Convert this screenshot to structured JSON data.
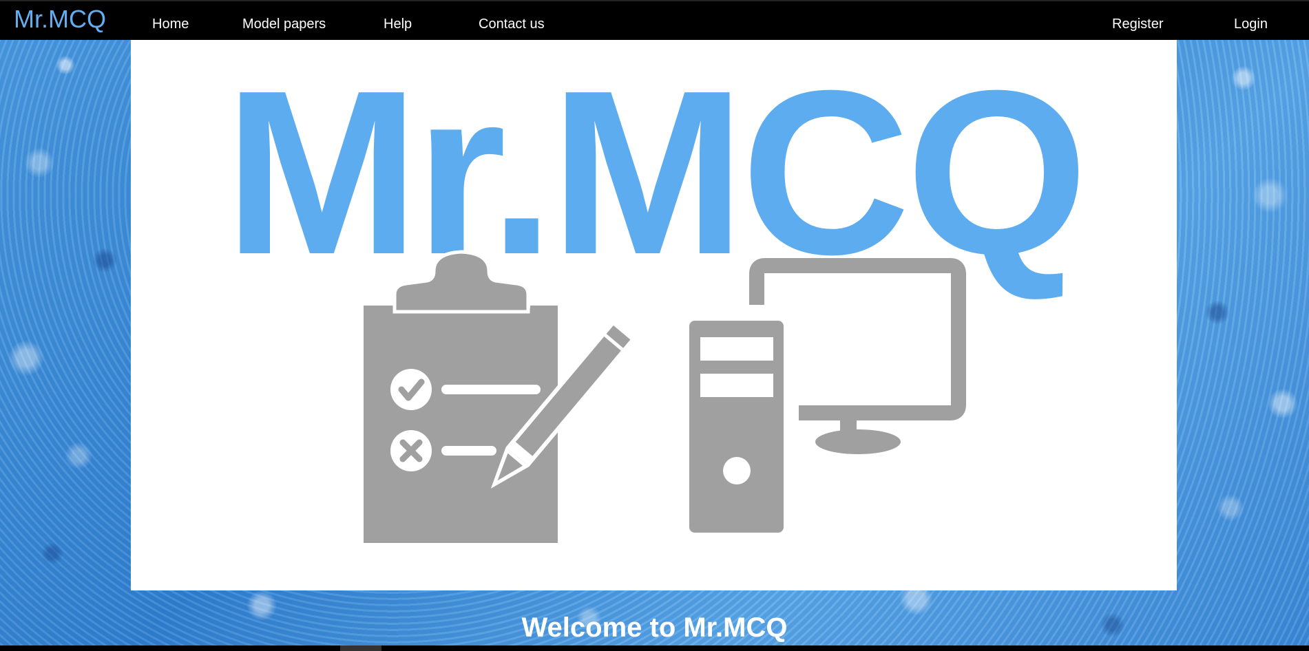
{
  "navbar": {
    "brand": "Mr.MCQ",
    "links": {
      "home": "Home",
      "model_papers": "Model papers",
      "help": "Help",
      "contact": "Contact us",
      "register": "Register",
      "login": "Login"
    }
  },
  "hero": {
    "logo_text": "Mr.MCQ",
    "icons": [
      "clipboard-checklist-icon",
      "pencil-icon",
      "desktop-computer-icon"
    ],
    "colors": {
      "logo_blue": "#5eacf0",
      "icon_gray": "#a0a0a0"
    }
  },
  "welcome": {
    "heading": "Welcome to Mr.MCQ"
  },
  "colors": {
    "navbar_bg": "#000000",
    "brand": "#61aef0",
    "background_blue": "#3f8fd8"
  }
}
